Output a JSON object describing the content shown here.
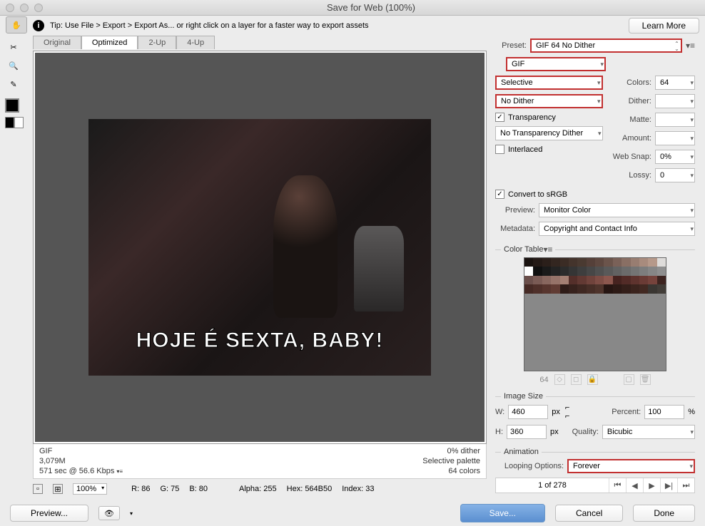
{
  "window": {
    "title": "Save for Web (100%)"
  },
  "tip": {
    "text": "Tip: Use File > Export > Export As...  or right click on a layer for a faster way to export assets",
    "learn_more": "Learn More"
  },
  "tabs": {
    "original": "Original",
    "optimized": "Optimized",
    "two_up": "2-Up",
    "four_up": "4-Up"
  },
  "meme": {
    "caption": "HOJE É SEXTA, BABY!"
  },
  "info": {
    "format": "GIF",
    "size": "3,079M",
    "time": "571 sec @ 56.6 Kbps",
    "dither": "0% dither",
    "palette": "Selective palette",
    "colors": "64 colors"
  },
  "status": {
    "zoom": "100%",
    "r": "R: 86",
    "g": "G: 75",
    "b": "B: 80",
    "alpha": "Alpha: 255",
    "hex": "Hex: 564B50",
    "index": "Index: 33"
  },
  "preset": {
    "label": "Preset:",
    "value": "GIF 64 No Dither",
    "format": "GIF",
    "reduction": "Selective",
    "dither_method": "No Dither",
    "colors_label": "Colors:",
    "colors": "64",
    "dither_label": "Dither:",
    "dither_val": "",
    "transparency": "Transparency",
    "transparency_dither": "No Transparency Dither",
    "matte_label": "Matte:",
    "amount_label": "Amount:",
    "amount": "",
    "interlaced": "Interlaced",
    "websnap_label": "Web Snap:",
    "websnap": "0%",
    "lossy_label": "Lossy:",
    "lossy": "0"
  },
  "color": {
    "convert": "Convert to sRGB",
    "preview_label": "Preview:",
    "preview": "Monitor Color",
    "metadata_label": "Metadata:",
    "metadata": "Copyright and Contact Info"
  },
  "color_table": {
    "header": "Color Table",
    "count": "64"
  },
  "image_size": {
    "header": "Image Size",
    "w_label": "W:",
    "w": "460",
    "h_label": "H:",
    "h": "360",
    "px": "px",
    "percent_label": "Percent:",
    "percent": "100",
    "pct": "%",
    "quality_label": "Quality:",
    "quality": "Bicubic"
  },
  "animation": {
    "header": "Animation",
    "loop_label": "Looping Options:",
    "loop": "Forever",
    "page": "1 of 278"
  },
  "buttons": {
    "preview": "Preview...",
    "save": "Save...",
    "cancel": "Cancel",
    "done": "Done"
  },
  "swatch_colors": [
    "#1a1310",
    "#241a16",
    "#2b1f1a",
    "#332620",
    "#3b2c25",
    "#44342c",
    "#4a3a31",
    "#554039",
    "#5e4840",
    "#6b544b",
    "#7a6158",
    "#896f64",
    "#987d71",
    "#a88b7d",
    "#b6998a",
    "#dedcda",
    "#ffffff",
    "#101010",
    "#1a1a1a",
    "#232323",
    "#2c2c2c",
    "#353535",
    "#3e3e3e",
    "#474747",
    "#505050",
    "#595959",
    "#626262",
    "#6b6b6b",
    "#747474",
    "#7d7d7d",
    "#868686",
    "#8f8f8f",
    "#6b4f4b",
    "#7a5b55",
    "#88675f",
    "#967369",
    "#a47f73",
    "#542f2a",
    "#623933",
    "#70433c",
    "#7e4d45",
    "#8c574e",
    "#462320",
    "#522b27",
    "#5e332e",
    "#6a3b35",
    "#76433c",
    "#3d2420",
    "#462a25",
    "#4f302a",
    "#58362f",
    "#613c34",
    "#2f1c18",
    "#37221d",
    "#3f2822",
    "#472e27",
    "#4f342c",
    "#261512",
    "#2d1a16",
    "#341f1a",
    "#3b241e",
    "#422922",
    "#3a3632",
    "#423d38"
  ]
}
